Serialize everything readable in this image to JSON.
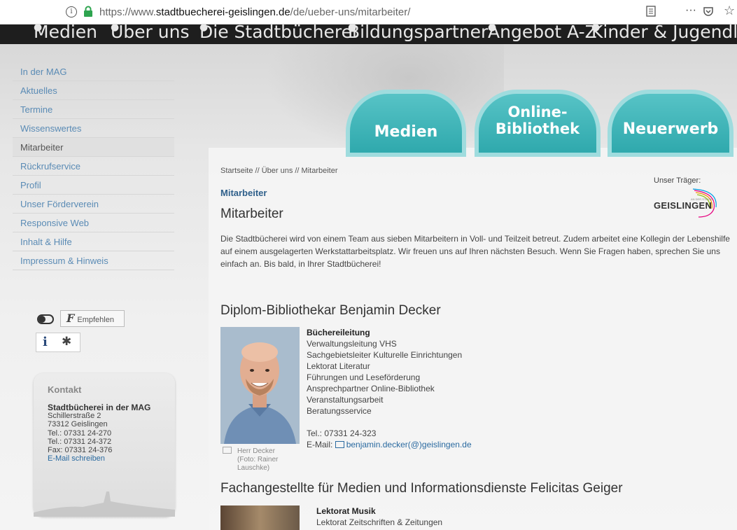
{
  "browser": {
    "url_prefix": "https://www.",
    "url_domain": "stadtbuecherei-geislingen.de",
    "url_path": "/de/ueber-uns/mitarbeiter/"
  },
  "topnav": [
    "Medien",
    "Über uns",
    "Die Stadtbücherei",
    "Bildungspartner",
    "Angebot A-Z",
    "Kinder & Jugendliche"
  ],
  "sidebar": {
    "items": [
      {
        "label": "In der MAG"
      },
      {
        "label": "Aktuelles"
      },
      {
        "label": "Termine"
      },
      {
        "label": "Wissenswertes"
      },
      {
        "label": "Mitarbeiter",
        "active": true
      },
      {
        "label": "Rückrufservice"
      },
      {
        "label": "Profil"
      },
      {
        "label": "Unser Förderverein"
      },
      {
        "label": "Responsive Web"
      },
      {
        "label": "Inhalt & Hilfe"
      },
      {
        "label": "Impressum & Hinweis"
      }
    ]
  },
  "tools": {
    "recommend": "Empfehlen",
    "info": "i"
  },
  "contact": {
    "heading": "Kontakt",
    "org": "Stadtbücherei in der MAG",
    "street": "Schillerstraße 2",
    "city": "73312 Geislingen",
    "tel1": "Tel.: 07331 24-270",
    "tel2": "Tel.: 07331 24-372",
    "fax": "Fax: 07331 24-376",
    "mail": "E-Mail schreiben"
  },
  "tabs": {
    "medien": "Medien",
    "online1": "Online-",
    "online2": "Bibliothek",
    "neuerwerb": "Neuerwerb"
  },
  "main": {
    "breadcrumb": "Startseite // Über uns  //  Mitarbeiter",
    "subtitle": "Mitarbeiter",
    "title": "Mitarbeiter",
    "intro": "Die Stadtbücherei wird von einem Team aus sieben Mitarbeitern in Voll- und Teilzeit betreut. Zudem arbeitet eine Kollegin der Lebenshilfe auf einem ausgelagerten Werkstattarbeitsplatz. Wir freuen uns auf Ihren nächsten Besuch. Wenn Sie Fragen haben, sprechen Sie uns einfach an. Bis bald, in Ihrer Stadtbücherei!",
    "traeger_label": "Unser Träger:",
    "logo_text": "GEISLINGEN",
    "logo_small": "AN DER STEIGE"
  },
  "staff": [
    {
      "name": "Diplom-Bibliothekar Benjamin Decker",
      "role": "Büchereileitung",
      "duties": [
        "Verwaltungsleitung VHS",
        "Sachgebietsleiter Kulturelle Einrichtungen",
        "Lektorat Literatur",
        "Führungen und Leseförderung",
        "Ansprechpartner Online-Bibliothek",
        "Veranstaltungsarbeit",
        "Beratungsservice"
      ],
      "tel": "Tel.: 07331 24-323",
      "mail_label": "E-Mail:",
      "mail": "benjamin.decker(@)geislingen.de",
      "caption1": "Herr Decker",
      "caption2": "(Foto: Rainer",
      "caption3": "Lauschke)"
    },
    {
      "name": "Fachangestellte für Medien und Informationsdienste Felicitas Geiger",
      "role": "Lektorat Musik",
      "duties": [
        "Lektorat Zeitschriften & Zeitungen"
      ]
    }
  ]
}
